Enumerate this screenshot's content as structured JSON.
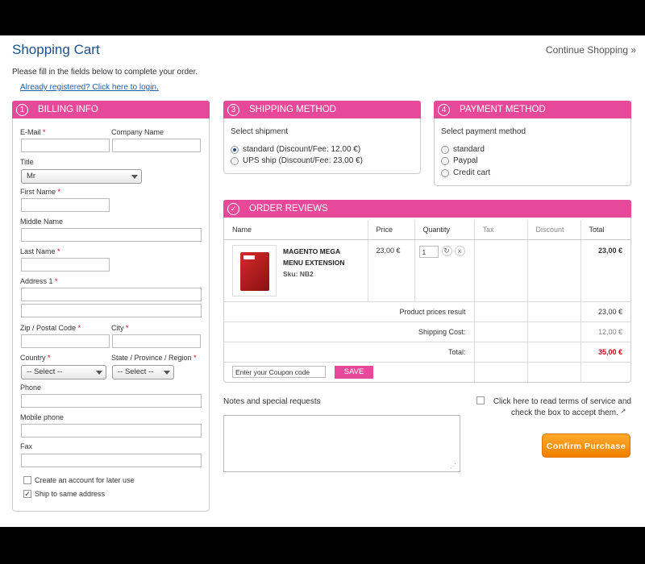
{
  "header": {
    "title": "Shopping Cart",
    "continue_link": "Continue Shopping »"
  },
  "intro": {
    "text": "Please fill in the fields below to complete your order.",
    "login_link": "Already registered? Click here to login."
  },
  "billing": {
    "number": "1",
    "title": "BILLING INFO",
    "email_label": "E-Mail",
    "company_label": "Company Name",
    "title_label": "Title",
    "title_value": "Mr",
    "first_name_label": "First Name",
    "middle_name_label": "Middle Name",
    "last_name_label": "Last Name",
    "address_label": "Address 1",
    "zip_label": "Zip / Postal Code",
    "city_label": "City",
    "country_label": "Country",
    "state_label": "State / Province / Region",
    "country_value": "-- Select --",
    "state_value": "-- Select --",
    "phone_label": "Phone",
    "mobile_label": "Mobile phone",
    "fax_label": "Fax",
    "create_account_label": "Create an account for later use",
    "create_account_checked": false,
    "ship_same_label": "Ship to same address",
    "ship_same_checked": true,
    "required_mark": "*"
  },
  "shipping": {
    "number": "3",
    "title": "SHIPPING METHOD",
    "subtitle": "Select shipment",
    "options": [
      {
        "label": "standard  (Discount/Fee: 12,00 €)",
        "selected": true
      },
      {
        "label": "UPS ship  (Discount/Fee: 23,00 €)",
        "selected": false
      }
    ]
  },
  "payment": {
    "number": "4",
    "title": "PAYMENT METHOD",
    "subtitle": "Select payment method",
    "options": [
      {
        "label": "standard",
        "selected": false
      },
      {
        "label": "Paypal",
        "selected": false
      },
      {
        "label": "Credit cart",
        "selected": false
      }
    ]
  },
  "order": {
    "icon": "✓",
    "title": "ORDER REVIEWS",
    "columns": [
      "Name",
      "Price",
      "Quantity",
      "Tax",
      "Discount",
      "Total"
    ],
    "item": {
      "name_line1": "MAGENTO MEGA",
      "name_line2": "MENU EXTENSION",
      "sku": "Sku: NB2",
      "price": "23,00 €",
      "quantity": "1",
      "total": "23,00 €"
    },
    "product_prices_label": "Product prices result",
    "product_prices_value": "23,00 €",
    "shipping_cost_label": "Shipping Cost:",
    "shipping_cost_value": "12,00 €",
    "total_label": "Total:",
    "total_value": "35,00 €",
    "coupon_placeholder": "Enter your Coupon code",
    "coupon_button": "SAVE"
  },
  "notes": {
    "label": "Notes and special requests"
  },
  "terms": {
    "line1": "Click here to read terms of service and",
    "line2": "check the box to accept them."
  },
  "confirm_button": "Confirm Purchase",
  "colors": {
    "accent": "#e6499a",
    "title_blue": "#1c4f8a",
    "total_red": "#d0021b",
    "confirm_orange": "#f39200"
  }
}
